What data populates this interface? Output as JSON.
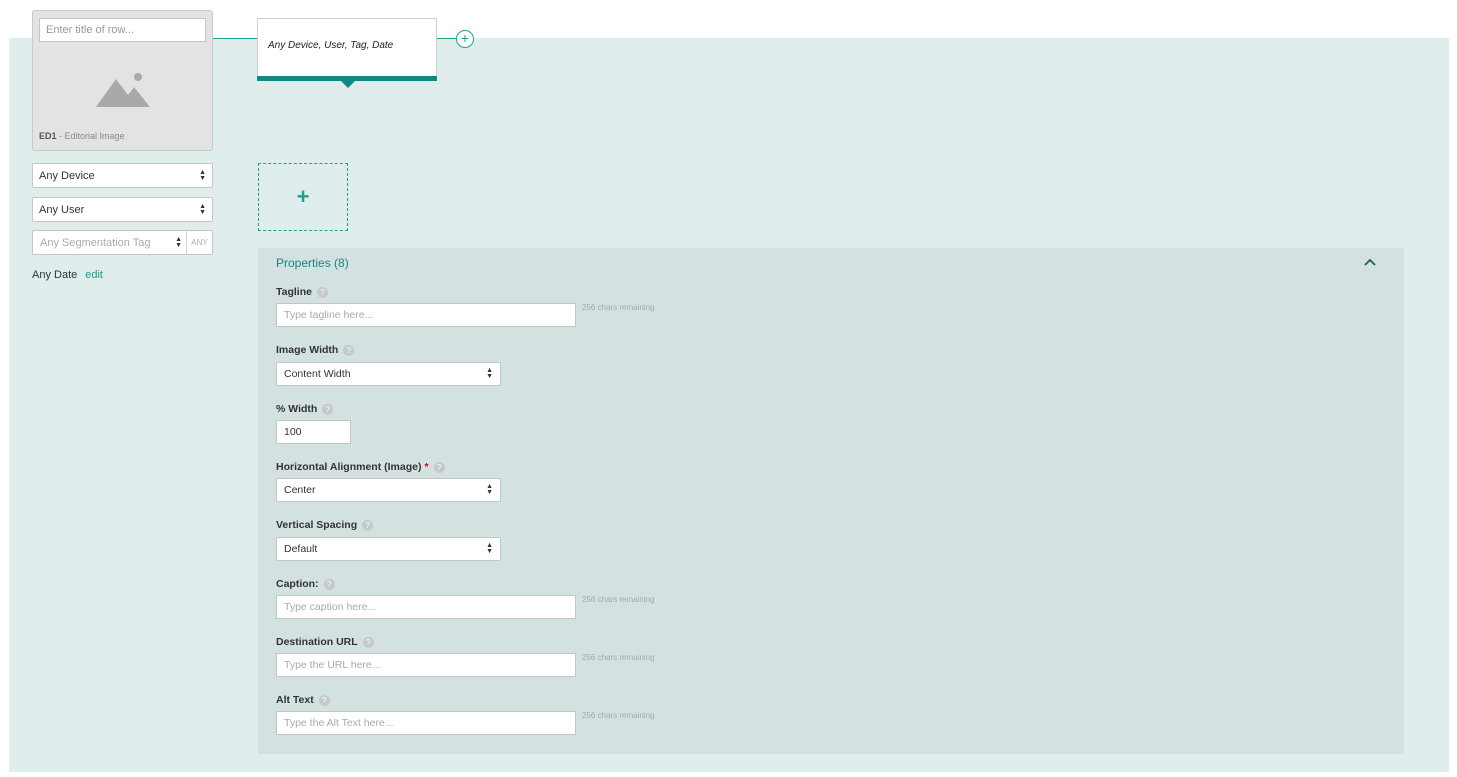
{
  "row": {
    "title_placeholder": "Enter title of row...",
    "code": "ED1",
    "type_label": " - Editorial Image"
  },
  "filters": {
    "device": "Any Device",
    "user": "Any User",
    "segmentation_placeholder": "Any Segmentation Tag",
    "any_badge": "ANY",
    "date": "Any Date",
    "edit_label": "edit"
  },
  "tab": {
    "label": "Any Device, User, Tag, Date",
    "add_symbol": "+"
  },
  "add_variant_symbol": "+",
  "properties": {
    "title": "Properties (8)",
    "help_symbol": "?",
    "required_symbol": "*",
    "tagline": {
      "label": "Tagline",
      "placeholder": "Type tagline here...",
      "chars": "256 chars remaining"
    },
    "image_width": {
      "label": "Image Width",
      "value": "Content Width"
    },
    "percent_width": {
      "label": "% Width",
      "value": "100"
    },
    "horizontal_alignment": {
      "label": "Horizontal Alignment (Image)",
      "value": "Center"
    },
    "vertical_spacing": {
      "label": "Vertical Spacing",
      "value": "Default"
    },
    "caption": {
      "label": "Caption:",
      "placeholder": "Type caption here...",
      "chars": "256 chars remaining"
    },
    "destination_url": {
      "label": "Destination URL",
      "placeholder": "Type the URL here...",
      "chars": "256 chars remaining"
    },
    "alt_text": {
      "label": "Alt Text",
      "placeholder": "Type the Alt Text here...",
      "chars": "256 chars remaining"
    }
  },
  "colors": {
    "accent": "#1fa191",
    "tab_bar": "#0e8a80",
    "canvas_bg": "#dfeded",
    "panel_bg": "#d4e1e1"
  }
}
